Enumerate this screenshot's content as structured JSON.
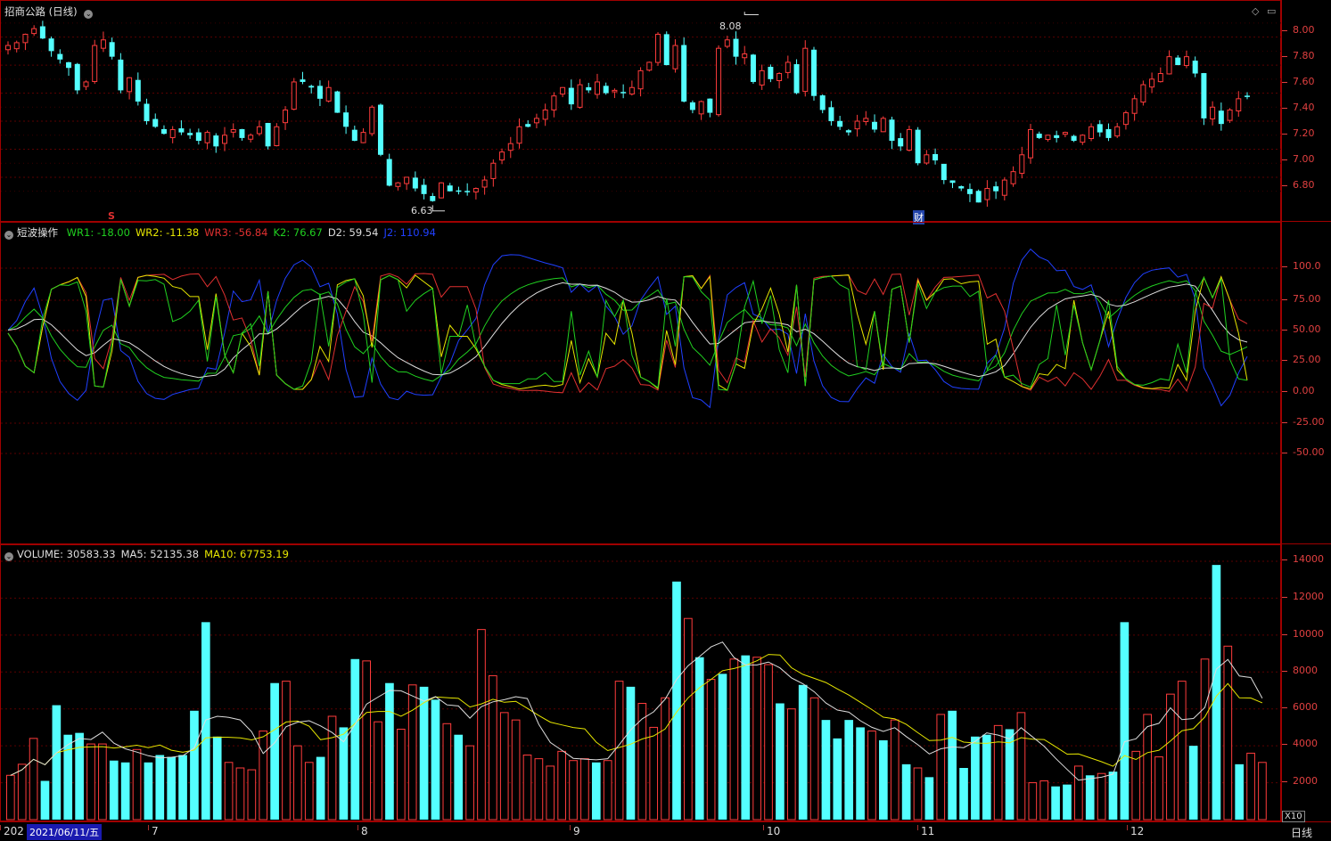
{
  "price_pane": {
    "title": "招商公路",
    "period_label": "(日线)",
    "high_label": "8.08",
    "low_label": "6.63",
    "marker_s": "S",
    "marker_cai": "财",
    "yticks": [
      "8.00",
      "7.80",
      "7.60",
      "7.40",
      "7.20",
      "7.00",
      "6.80"
    ],
    "ymin": 6.62,
    "ymax": 8.12
  },
  "osc_pane": {
    "name": "短波操作",
    "values": [
      {
        "label": "WR1: -18.00",
        "color": "#20d020"
      },
      {
        "label": "WR2: -11.38",
        "color": "#e6e600"
      },
      {
        "label": "WR3: -56.84",
        "color": "#e03030"
      },
      {
        "label": "K2: 76.67",
        "color": "#20d020"
      },
      {
        "label": "D2: 59.54",
        "color": "#dddddd"
      },
      {
        "label": "J2: 110.94",
        "color": "#2040ff"
      }
    ],
    "yticks": [
      "100.0",
      "75.00",
      "50.00",
      "25.00",
      "0.00",
      "-25.00",
      "-50.00"
    ]
  },
  "volume_pane": {
    "values": [
      {
        "label": "VOLUME: 30583.33",
        "color": "#dddddd"
      },
      {
        "label": "MA5: 52135.38",
        "color": "#dddddd"
      },
      {
        "label": "MA10: 67753.19",
        "color": "#e6e600"
      }
    ],
    "yticks": [
      "14000",
      "12000",
      "10000",
      "8000",
      "6000",
      "4000",
      "2000"
    ],
    "scale_label": "X10"
  },
  "x_axis": {
    "date_box": "2021/06/11/五",
    "partial_year": "202",
    "months": [
      {
        "label": "7",
        "x": 170
      },
      {
        "label": "8",
        "x": 405
      },
      {
        "label": "9",
        "x": 643
      },
      {
        "label": "10",
        "x": 860
      },
      {
        "label": "11",
        "x": 1033
      },
      {
        "label": "12",
        "x": 1268
      }
    ],
    "period": "日线"
  },
  "colors": {
    "up": "#ff3c3c",
    "down": "#54ffff",
    "k": "#20d020",
    "d": "#dddddd",
    "j": "#2040ff",
    "wr1": "#20d020",
    "wr2": "#e6e600",
    "wr3": "#e03030",
    "ma5": "#dddddd",
    "ma10": "#e6e600"
  },
  "chart_data": {
    "type": "candlestick",
    "closes": [
      7.84,
      7.86,
      7.92,
      7.96,
      7.89,
      7.8,
      7.74,
      7.68,
      7.52,
      7.58,
      7.84,
      7.88,
      7.76,
      7.52,
      7.61,
      7.44,
      7.3,
      7.26,
      7.21,
      7.24,
      7.22,
      7.2,
      7.16,
      7.22,
      7.12,
      7.2,
      7.24,
      7.18,
      7.2,
      7.26,
      7.12,
      7.26,
      7.38,
      7.58,
      7.58,
      7.54,
      7.46,
      7.54,
      7.36,
      7.26,
      7.16,
      7.22,
      7.4,
      7.06,
      6.84,
      6.86,
      6.9,
      6.82,
      6.78,
      6.73,
      6.86,
      6.8,
      6.8,
      6.8,
      6.82,
      6.88,
      7.0,
      7.08,
      7.14,
      7.26,
      7.26,
      7.32,
      7.38,
      7.48,
      7.54,
      7.42,
      7.56,
      7.52,
      7.58,
      7.5,
      7.52,
      7.5,
      7.54,
      7.66,
      7.72,
      7.92,
      7.7,
      7.84,
      7.44,
      7.38,
      7.44,
      7.36,
      7.82,
      7.88,
      7.76,
      7.78,
      7.58,
      7.66,
      7.6,
      7.64,
      7.72,
      7.5,
      7.82,
      7.48,
      7.38,
      7.3,
      7.26,
      7.22,
      7.3,
      7.32,
      7.24,
      7.32,
      7.16,
      7.12,
      7.24,
      7.0,
      7.06,
      7.02,
      6.88,
      6.86,
      6.82,
      6.78,
      6.72,
      6.82,
      6.8,
      6.88,
      6.94,
      7.06,
      7.24,
      7.18,
      7.2,
      7.18,
      7.22,
      7.16,
      7.2,
      7.26,
      7.22,
      7.18,
      7.26,
      7.36,
      7.46,
      7.56,
      7.6,
      7.64,
      7.76,
      7.7,
      7.76,
      7.64,
      7.32,
      7.4,
      7.28,
      7.38,
      7.46,
      7.48
    ],
    "volume": [
      2400,
      3000,
      4400,
      2100,
      6200,
      4600,
      4700,
      4100,
      4100,
      3200,
      3100,
      3800,
      3100,
      3500,
      3400,
      3500,
      5900,
      10700,
      4500,
      3100,
      2800,
      2700,
      4800,
      7400,
      7500,
      4000,
      3100,
      3400,
      5600,
      5000,
      8700,
      8600,
      5300,
      7400,
      4900,
      7300,
      7200,
      6500,
      5200,
      4600,
      4000,
      10300,
      7800,
      5800,
      5400,
      3500,
      3300,
      2900,
      3700,
      3200,
      3300,
      3100,
      3200,
      7500,
      7200,
      6300,
      5000,
      6600,
      12900,
      10900,
      8800,
      7600,
      7900,
      8700,
      8900,
      8800,
      8400,
      6300,
      6000,
      7300,
      6600,
      5400,
      4400,
      5400,
      5000,
      4800,
      4300,
      5400,
      3000,
      2800,
      2300,
      5700,
      5900,
      2800,
      4500,
      4600,
      5100,
      4900,
      5800,
      2000,
      2100,
      1800,
      1900,
      2900,
      2400,
      2500,
      2600,
      10700,
      3700,
      5700,
      3400,
      6800,
      7500,
      4000,
      8700,
      13800,
      9400,
      3000,
      3600,
      3100
    ],
    "ylim": [
      6.62,
      8.12
    ]
  }
}
